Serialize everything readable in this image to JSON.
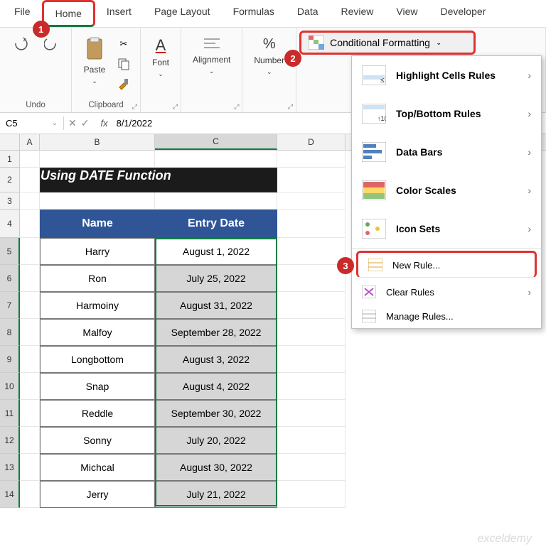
{
  "tabs": [
    "File",
    "Home",
    "Insert",
    "Page Layout",
    "Formulas",
    "Data",
    "Review",
    "View",
    "Developer"
  ],
  "active_tab": 1,
  "ribbon": {
    "undo_label": "Undo",
    "clipboard_label": "Clipboard",
    "paste_label": "Paste",
    "font_label": "Font",
    "alignment_label": "Alignment",
    "number_label": "Number",
    "cf_label": "Conditional Formatting"
  },
  "name_box": "C5",
  "fx": "fx",
  "formula_value": "8/1/2022",
  "columns": [
    "A",
    "B",
    "C",
    "D"
  ],
  "table_title": "Using DATE Function",
  "headers": {
    "col1": "Name",
    "col2": "Entry Date"
  },
  "rows": [
    {
      "name": "Harry",
      "date": "August 1, 2022",
      "shade": false
    },
    {
      "name": "Ron",
      "date": "July 25, 2022",
      "shade": true
    },
    {
      "name": "Harmoiny",
      "date": "August 31, 2022",
      "shade": true
    },
    {
      "name": "Malfoy",
      "date": "September 28, 2022",
      "shade": true
    },
    {
      "name": "Longbottom",
      "date": "August 3, 2022",
      "shade": true
    },
    {
      "name": "Snap",
      "date": "August 4, 2022",
      "shade": true
    },
    {
      "name": "Reddle",
      "date": "September 30, 2022",
      "shade": true
    },
    {
      "name": "Sonny",
      "date": "July 20, 2022",
      "shade": true
    },
    {
      "name": "Michcal",
      "date": "August 30, 2022",
      "shade": true
    },
    {
      "name": "Jerry",
      "date": "July 21, 2022",
      "shade": true
    }
  ],
  "row_nums": [
    1,
    2,
    3,
    4,
    5,
    6,
    7,
    8,
    9,
    10,
    11,
    12,
    13,
    14
  ],
  "cf_menu": {
    "highlight": "Highlight Cells Rules",
    "topbottom": "Top/Bottom Rules",
    "databars": "Data Bars",
    "colorscales": "Color Scales",
    "iconsets": "Icon Sets",
    "newrule": "New Rule...",
    "clear": "Clear Rules",
    "manage": "Manage Rules..."
  },
  "markers": {
    "m1": "1",
    "m2": "2",
    "m3": "3"
  },
  "watermark": "exceldemy"
}
